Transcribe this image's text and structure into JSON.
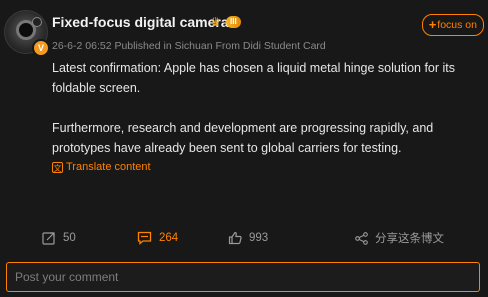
{
  "post": {
    "username": "Fixed-focus digital cameras",
    "level_badge": "III",
    "verified_badge": "V",
    "meta": "26-6-2 06:52 Published in Sichuan From Didi Student Card",
    "follow_label": "focus on",
    "paragraphs": [
      "Latest confirmation: Apple has chosen a liquid metal hinge solution for its foldable screen.",
      "Furthermore, research and development are progressing rapidly, and prototypes have already been sent to global carriers for testing."
    ],
    "translate_label": "Translate content"
  },
  "actions": {
    "repost_count": "50",
    "comment_count": "264",
    "like_count": "993",
    "share_label": "分享这条博文"
  },
  "comment_input": {
    "placeholder": "Post your comment",
    "value": ""
  },
  "colors": {
    "accent": "#ff8200",
    "background": "#181818",
    "text_primary": "#e6e6e6",
    "text_muted": "#8a8a8a"
  },
  "icons": {
    "repost": "repost-icon",
    "comment": "comment-icon",
    "like": "like-icon",
    "share": "share-icon",
    "translate": "translate-icon",
    "crown": "crown-icon"
  }
}
